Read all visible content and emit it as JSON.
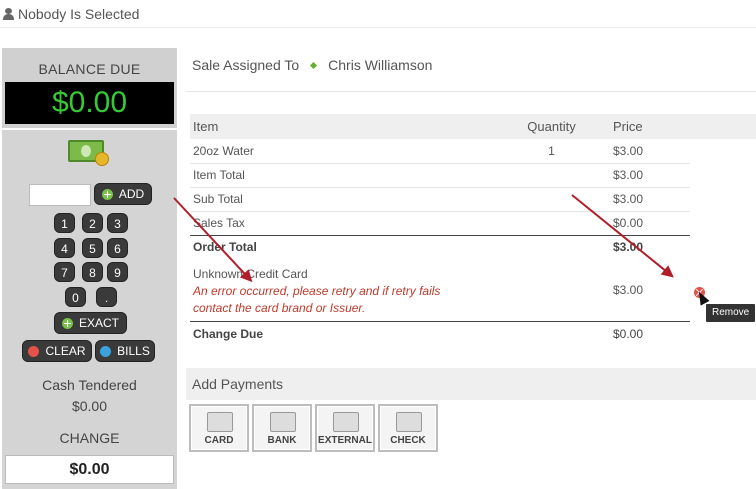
{
  "header": {
    "selection": "Nobody Is Selected"
  },
  "left": {
    "balance_label": "BALANCE DUE",
    "balance_value": "$0.00",
    "add_label": "ADD",
    "keys": [
      "1",
      "2",
      "3",
      "4",
      "5",
      "6",
      "7",
      "8",
      "9",
      "0",
      "."
    ],
    "exact_label": "EXACT",
    "clear_label": "CLEAR",
    "bills_label": "BILLS",
    "cash_tendered_label": "Cash Tendered",
    "cash_tendered_value": "$0.00",
    "change_label": "CHANGE",
    "change_value": "$0.00"
  },
  "sale": {
    "assigned_label": "Sale Assigned To",
    "customer": "Chris Williamson"
  },
  "table": {
    "headers": {
      "item": "Item",
      "quantity": "Quantity",
      "price": "Price"
    },
    "line_item": {
      "name": "20oz Water",
      "qty": "1",
      "price": "$3.00"
    },
    "item_total": {
      "label": "Item Total",
      "value": "$3.00"
    },
    "sub_total": {
      "label": "Sub Total",
      "value": "$3.00"
    },
    "sales_tax": {
      "label": "Sales Tax",
      "value": "$0.00"
    },
    "order_total": {
      "label": "Order Total",
      "value": "$3.00"
    },
    "payment": {
      "name": "Unknown Credit Card",
      "error": "An error occurred, please retry and if retry fails contact the card brand or Issuer.",
      "value": "$3.00"
    },
    "change_due": {
      "label": "Change Due",
      "value": "$0.00"
    }
  },
  "tooltip": "Remove",
  "payments": {
    "title": "Add Payments",
    "buttons": [
      "CARD",
      "BANK",
      "EXTERNAL",
      "CHECK"
    ]
  },
  "colors": {
    "display_green": "#33cc33",
    "arrow": "#b01e2a",
    "error": "#c0392b",
    "add_green": "#79c14b",
    "clear_red": "#e4524a",
    "bills_blue": "#3aa3dd"
  },
  "icons": [
    "person-icon",
    "money-icon",
    "plus-icon",
    "x-icon",
    "info-icon",
    "remove-icon",
    "cursor-icon",
    "card-icon",
    "bank-icon",
    "external-icon",
    "check-icon"
  ]
}
